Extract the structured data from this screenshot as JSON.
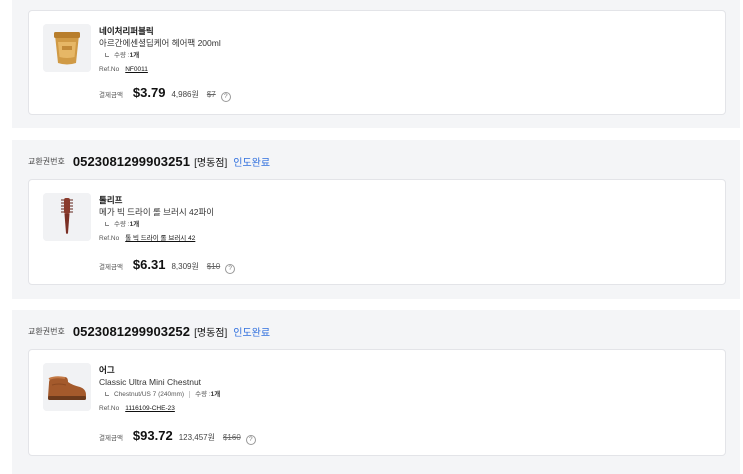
{
  "labels": {
    "exchange_no": "교환권번호",
    "quantity": "수량 :",
    "ref_no": "Ref.No",
    "payment": "결제금액",
    "help": "?"
  },
  "orders": [
    {
      "exchange_number": "",
      "store": "",
      "status": "",
      "item": {
        "brand": "네이처리퍼블릭",
        "name": "아르간에센셜딥케어 헤어팩 200ml",
        "option": "",
        "quantity": "1개",
        "ref_no": "NF0011",
        "price_usd": "$3.79",
        "price_krw": "4,986원",
        "original_price": "$7",
        "image": "hair-pack-jar-icon"
      }
    },
    {
      "exchange_number": "0523081299903251",
      "store": "[명동점]",
      "status": "인도완료",
      "item": {
        "brand": "톨리프",
        "name": "메가 빅 드라이 롤 브러시 42파이",
        "option": "",
        "quantity": "1개",
        "ref_no": "톨 빅 드라이 롤 브러시 42",
        "price_usd": "$6.31",
        "price_krw": "8,309원",
        "original_price": "$10",
        "image": "roll-brush-icon"
      }
    },
    {
      "exchange_number": "0523081299903252",
      "store": "[명동점]",
      "status": "인도완료",
      "item": {
        "brand": "어그",
        "name": "Classic Ultra Mini Chestnut",
        "option": "Chestnut/US 7 (240mm)",
        "quantity": "1개",
        "ref_no": "1116109-CHE-23",
        "price_usd": "$93.72",
        "price_krw": "123,457원",
        "original_price": "$160",
        "image": "chestnut-boot-icon"
      }
    }
  ],
  "colors": {
    "status_blue": "#2f6fde",
    "panel_bg": "#f4f5f7",
    "card_border": "#e3e4e8"
  }
}
